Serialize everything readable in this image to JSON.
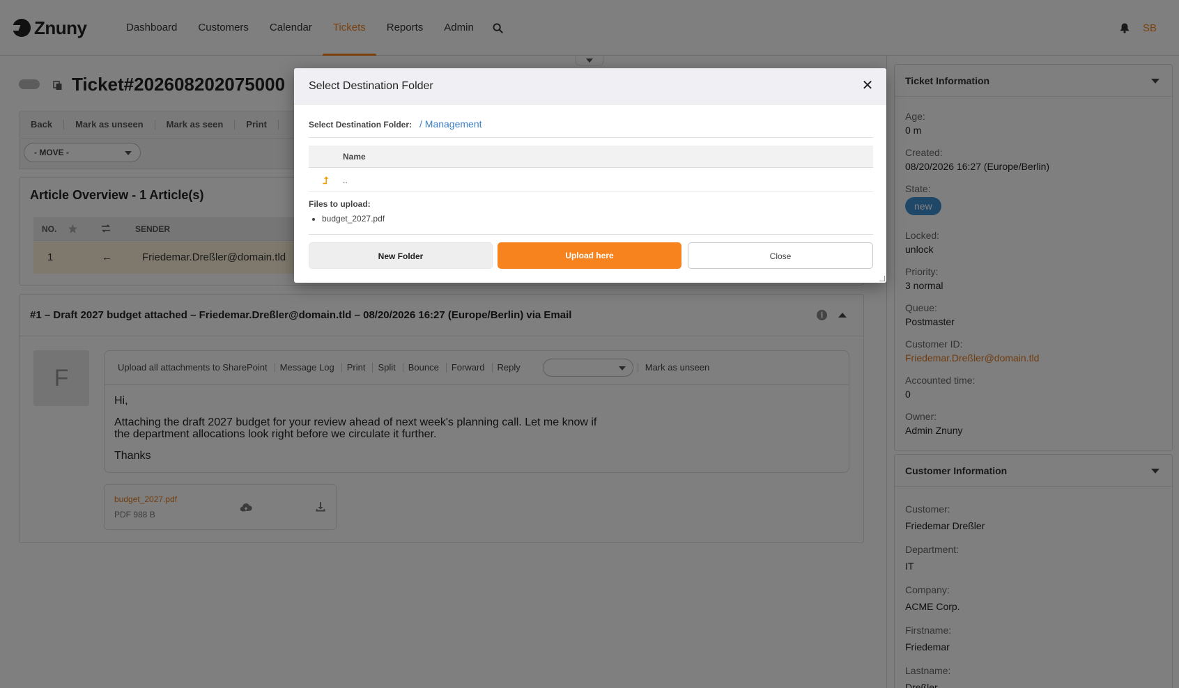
{
  "header": {
    "logo_text": "Znuny",
    "nav": [
      {
        "label": "Dashboard",
        "active": false
      },
      {
        "label": "Customers",
        "active": false
      },
      {
        "label": "Calendar",
        "active": false
      },
      {
        "label": "Tickets",
        "active": true
      },
      {
        "label": "Reports",
        "active": false
      },
      {
        "label": "Admin",
        "active": false
      }
    ],
    "search_icon": "search-icon",
    "bell_icon": "bell-icon",
    "user_initials": "SB"
  },
  "ticket": {
    "title": "Ticket#202608202075000",
    "actions": [
      "Back",
      "Mark as unseen",
      "Mark as seen",
      "Print"
    ],
    "move_select": "- MOVE -"
  },
  "article_overview": {
    "title": "Article Overview - 1 Article(s)",
    "columns": [
      "NO.",
      "SENDER"
    ],
    "row": {
      "no": "1",
      "direction": "←",
      "sender": "Friedemar.Dreßler@domain.tld"
    }
  },
  "article": {
    "title": "#1 – Draft 2027 budget attached – Friedemar.Dreßler@domain.tld – 08/20/2026 16:27 (Europe/Berlin) via Email",
    "avatar_letter": "F",
    "actions": [
      "Upload all attachments to SharePoint",
      "Message Log",
      "Print",
      "Split",
      "Bounce",
      "Forward",
      "Reply"
    ],
    "mark_unseen": "Mark as unseen",
    "body": {
      "greeting": "Hi,",
      "paragraph": "Attaching the draft 2027 budget for your review ahead of next week's planning call. Let me know if the department allocations look right before we circulate it further.",
      "closing": "Thanks"
    },
    "attachment": {
      "name": "budget_2027.pdf",
      "meta": "PDF 988 B"
    }
  },
  "ticket_info": {
    "title": "Ticket Information",
    "fields": [
      {
        "label": "Age:",
        "value": "0 m"
      },
      {
        "label": "Created:",
        "value": "08/20/2026 16:27 (Europe/Berlin)"
      },
      {
        "label": "State:",
        "value": "new"
      },
      {
        "label": "Locked:",
        "value": "unlock"
      },
      {
        "label": "Priority:",
        "value": "3 normal"
      },
      {
        "label": "Queue:",
        "value": "Postmaster"
      },
      {
        "label": "Customer ID:",
        "value": "Friedemar.Dreßler@domain.tld"
      },
      {
        "label": "Accounted time:",
        "value": "0"
      },
      {
        "label": "Owner:",
        "value": "Admin Znuny"
      }
    ]
  },
  "customer_info": {
    "title": "Customer Information",
    "fields": [
      {
        "label": "Customer:",
        "value": "Friedemar Dreßler"
      },
      {
        "label": "Department:",
        "value": "IT"
      },
      {
        "label": "Company:",
        "value": "ACME Corp."
      },
      {
        "label": "Firstname:",
        "value": "Friedemar"
      },
      {
        "label": "Lastname:",
        "value": "Dreßler"
      }
    ]
  },
  "modal": {
    "title": "Select Destination Folder",
    "folder_label": "Select Destination Folder:",
    "folder_path": "/ Management",
    "table_header": "Name",
    "parent_row": "..",
    "files_label": "Files to upload:",
    "files": [
      "budget_2027.pdf"
    ],
    "buttons": {
      "new_folder": "New Folder",
      "upload": "Upload here",
      "close": "Close"
    }
  },
  "colors": {
    "accent": "#f7831e",
    "link_blue": "#3a7fc8",
    "state_badge": "#3e8ed0",
    "row_highlight": "#fdf2d8"
  }
}
